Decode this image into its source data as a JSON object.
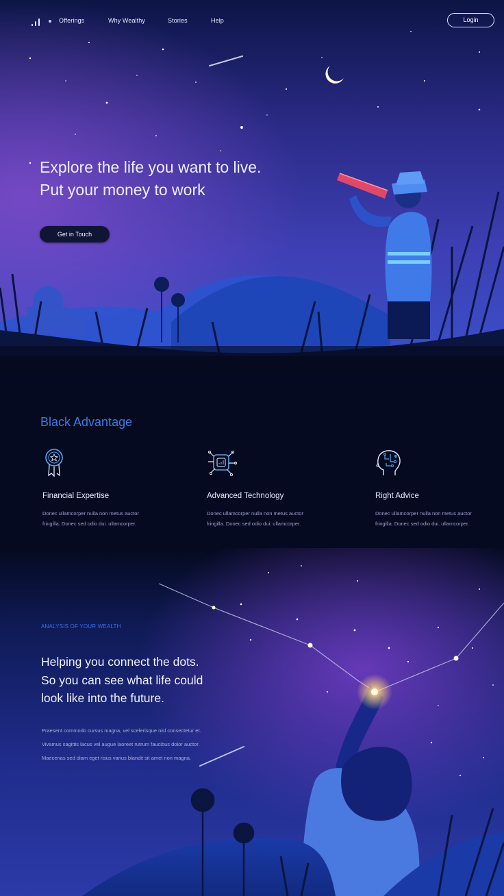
{
  "nav": {
    "links": [
      {
        "label": "Offerings"
      },
      {
        "label": "Why Wealthy"
      },
      {
        "label": "Stories"
      },
      {
        "label": "Help"
      }
    ],
    "login_label": "Login"
  },
  "hero": {
    "title_lines": [
      "Explore the life you want to live.",
      "Put your money to work"
    ],
    "cta_label": "Get in Touch"
  },
  "advantage": {
    "title": "Black Advantage",
    "features": [
      {
        "icon": "award-ribbon-icon",
        "title": "Financial Expertise",
        "desc": "Donec ullamcorper nulla non metus auctor fringilla. Donec sed odio dui. ullamcorper."
      },
      {
        "icon": "circuit-chip-icon",
        "title": "Advanced Technology",
        "desc": "Donec ullamcorper nulla non metus auctor fringilla. Donec sed odio dui. ullamcorper."
      },
      {
        "icon": "brain-head-icon",
        "title": "Right Advice",
        "desc": "Donec ullamcorper nulla non metus auctor fringilla. Donec sed odio dui. ullamcorper."
      }
    ]
  },
  "analysis": {
    "kicker": "ANALYSIS OF YOUR WEALTH",
    "title_lines": [
      "Helping you connect the dots.",
      "So you can see what life could",
      "look like into the future."
    ],
    "body_lines": [
      "Praesent commodo cursus magna, vel scelerisque nisl consectetur et.",
      "Vivamus sagittis lacus vel augue laoreet rutrum faucibus dolor auctor.",
      "Maecenas sed diam eget risus varius blandit sit amet non magna."
    ]
  },
  "colors": {
    "sky_top": "#0d1848",
    "sky_purple": "#5b3fb0",
    "dark_band": "#050a20",
    "accent_blue": "#3a7be0",
    "text_light": "#eceeff"
  }
}
